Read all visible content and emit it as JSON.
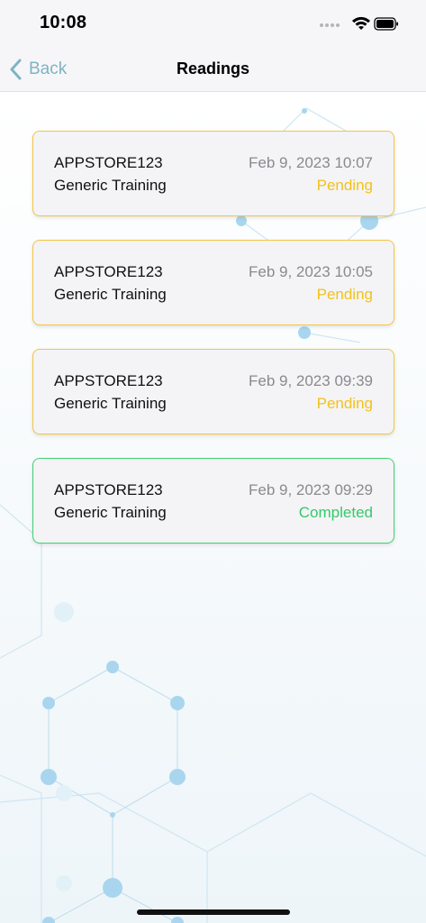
{
  "status_bar": {
    "time": "10:08",
    "icons": [
      "signal-dots-icon",
      "wifi-icon",
      "battery-icon"
    ]
  },
  "nav": {
    "back_label": "Back",
    "title": "Readings"
  },
  "colors": {
    "pending": "#f2c21b",
    "completed": "#33c96a",
    "pending_border": "#f5c542",
    "completed_border": "#43cf73",
    "back_tint": "#7fb4c4"
  },
  "readings": [
    {
      "code": "APPSTORE123",
      "name": "Generic Training",
      "date": "Feb 9, 2023 10:07",
      "status": "Pending"
    },
    {
      "code": "APPSTORE123",
      "name": "Generic Training",
      "date": "Feb 9, 2023 10:05",
      "status": "Pending"
    },
    {
      "code": "APPSTORE123",
      "name": "Generic Training",
      "date": "Feb 9, 2023 09:39",
      "status": "Pending"
    },
    {
      "code": "APPSTORE123",
      "name": "Generic Training",
      "date": "Feb 9, 2023 09:29",
      "status": "Completed"
    }
  ]
}
